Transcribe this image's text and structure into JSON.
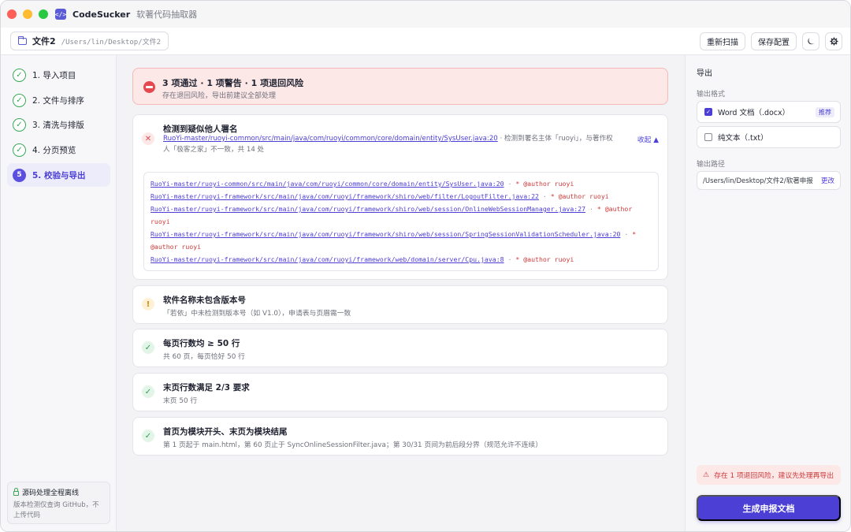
{
  "app": {
    "name": "CodeSucker",
    "subtitle": "软著代码抽取器",
    "logo_glyph": "</>"
  },
  "toolbar": {
    "project_name": "文件2",
    "project_path": "/Users/lin/Desktop/文件2",
    "rescan_label": "重新扫描",
    "save_config_label": "保存配置",
    "theme_icon": "moon-icon",
    "settings_icon": "gear-icon"
  },
  "sidebar": {
    "steps": [
      {
        "label": "1. 导入项目",
        "state": "done"
      },
      {
        "label": "2. 文件与排序",
        "state": "done"
      },
      {
        "label": "3. 清洗与排版",
        "state": "done"
      },
      {
        "label": "4. 分页预览",
        "state": "done"
      },
      {
        "label": "5. 校验与导出",
        "state": "active",
        "number": "5"
      }
    ],
    "offline": {
      "title": "源码处理全程离线",
      "desc": "版本检测仅查询 GitHub，不上传代码"
    }
  },
  "summary": {
    "title": "3 项通过 · 1 项警告 · 1 项退回风险",
    "subtitle": "存在退回风险，导出前建议全部处理"
  },
  "checks": {
    "authorship": {
      "status": "fail",
      "icon": "✕",
      "title": "检测到疑似他人署名",
      "location": "RuoYi-master/ruoyi-common/src/main/java/com/ruoyi/common/core/domain/entity/SysUser.java:20",
      "desc": " · 检测到署名主体「ruoyi」，与著作权人「极客之家」不一致，共 14 处",
      "collapse_label": "收起 ▲",
      "evidence": [
        {
          "path": "RuoYi-master/ruoyi-common/src/main/java/com/ruoyi/common/core/domain/entity/SysUser.java:20",
          "sep": " · ",
          "text": "* @author ruoyi"
        },
        {
          "path": "RuoYi-master/ruoyi-framework/src/main/java/com/ruoyi/framework/shiro/web/filter/LogoutFilter.java:22",
          "sep": " · ",
          "text": "* @author ruoyi"
        },
        {
          "path": "RuoYi-master/ruoyi-framework/src/main/java/com/ruoyi/framework/shiro/web/session/OnlineWebSessionManager.java:27",
          "sep": " · ",
          "text": "* @author ruoyi"
        },
        {
          "path": "RuoYi-master/ruoyi-framework/src/main/java/com/ruoyi/framework/shiro/web/session/SpringSessionValidationScheduler.java:20",
          "sep": " · ",
          "text": "* @author ruoyi"
        },
        {
          "path": "RuoYi-master/ruoyi-framework/src/main/java/com/ruoyi/framework/web/domain/server/Cpu.java:8",
          "sep": " · ",
          "text": "* @author ruoyi"
        }
      ]
    },
    "version": {
      "status": "warn",
      "icon": "!",
      "title": "软件名称未包含版本号",
      "desc": "「若依」中未检测到版本号（如 V1.0），申请表与页眉需一致"
    },
    "lines_per_page": {
      "status": "pass",
      "icon": "✓",
      "title": "每页行数均 ≥ 50 行",
      "desc": "共 60 页，每页恰好 50 行"
    },
    "last_page": {
      "status": "pass",
      "icon": "✓",
      "title": "末页行数满足 2/3 要求",
      "desc": "末页 50 行"
    },
    "module_boundary": {
      "status": "pass",
      "icon": "✓",
      "title": "首页为模块开头、末页为模块结尾",
      "desc": "第 1 页起于 main.html，第 60 页止于 SyncOnlineSessionFilter.java；第 30/31 页间为前后段分界（规范允许不连续）"
    }
  },
  "export": {
    "title": "导出",
    "format_label": "输出格式",
    "formats": [
      {
        "label": "Word 文档（.docx）",
        "checked": true,
        "badge": "推荐"
      },
      {
        "label": "纯文本（.txt）",
        "checked": false
      }
    ],
    "path_label": "输出路径",
    "path_value": "/Users/lin/Desktop/文件2/软著申报",
    "path_change": "更改",
    "risk_note": "存在 1 项退回风险，建议先处理再导出",
    "generate_label": "生成申报文档"
  },
  "colors": {
    "accent": "#4b3fd6",
    "pass": "#2e9b4d",
    "warn": "#d78a00",
    "fail": "#e5484d"
  }
}
